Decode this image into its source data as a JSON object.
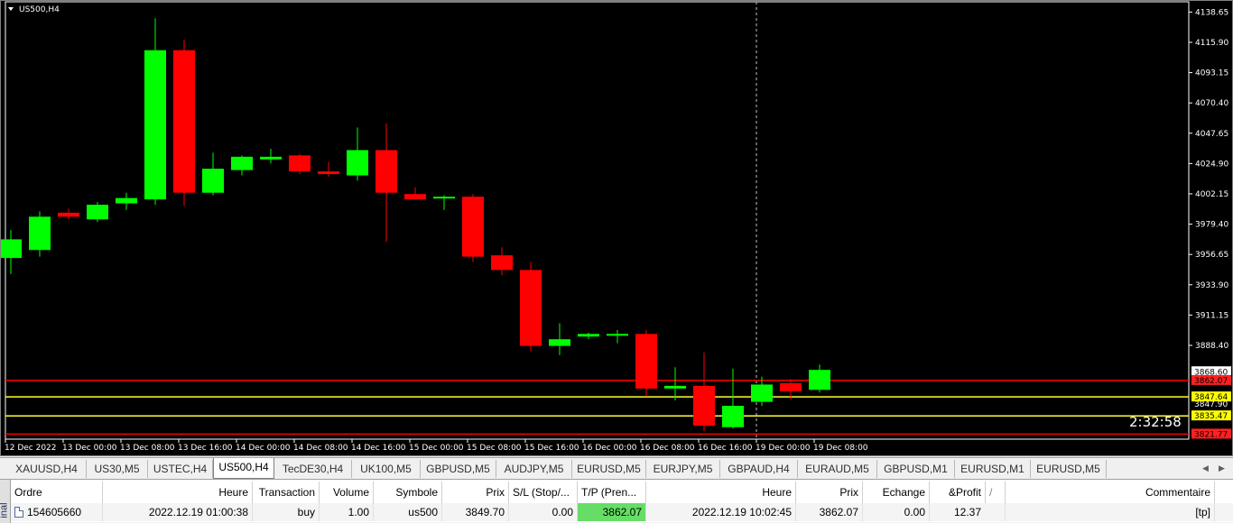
{
  "chart_title": "US500,H4",
  "chart_data": {
    "type": "candlestick",
    "symbol": "US500",
    "timeframe": "H4",
    "ylim": [
      3822,
      4150
    ],
    "y_ticks": [
      "4138.65",
      "4115.90",
      "4093.15",
      "4070.40",
      "4047.65",
      "4024.90",
      "4002.15",
      "3979.40",
      "3956.65",
      "3933.90",
      "3911.15",
      "3888.40"
    ],
    "y_ticks_values": [
      4138.65,
      4115.9,
      4093.15,
      4070.4,
      4047.65,
      4024.9,
      4002.15,
      3979.4,
      3956.65,
      3933.9,
      3911.15,
      3888.4
    ],
    "x_labels": [
      "12 Dec 2022",
      "13 Dec 00:00",
      "13 Dec 08:00",
      "13 Dec 16:00",
      "14 Dec 00:00",
      "14 Dec 08:00",
      "14 Dec 16:00",
      "15 Dec 00:00",
      "15 Dec 08:00",
      "15 Dec 16:00",
      "16 Dec 00:00",
      "16 Dec 08:00",
      "16 Dec 16:00",
      "19 Dec 00:00",
      "19 Dec 08:00"
    ],
    "candles": [
      {
        "o": 3954,
        "h": 3975,
        "l": 3942,
        "c": 3968
      },
      {
        "o": 3960,
        "h": 3989,
        "l": 3955,
        "c": 3985
      },
      {
        "o": 3988,
        "h": 3991,
        "l": 3983,
        "c": 3985
      },
      {
        "o": 3983,
        "h": 3996,
        "l": 3981,
        "c": 3994
      },
      {
        "o": 3995,
        "h": 4003,
        "l": 3990,
        "c": 3999
      },
      {
        "o": 3998,
        "h": 4134,
        "l": 3994,
        "c": 4110
      },
      {
        "o": 4110,
        "h": 4118,
        "l": 3993,
        "c": 4003
      },
      {
        "o": 4003,
        "h": 4033,
        "l": 4001,
        "c": 4021
      },
      {
        "o": 4020,
        "h": 4031,
        "l": 4016,
        "c": 4030
      },
      {
        "o": 4028,
        "h": 4036,
        "l": 4025,
        "c": 4030
      },
      {
        "o": 4031,
        "h": 4032,
        "l": 4017,
        "c": 4019
      },
      {
        "o": 4019,
        "h": 4026,
        "l": 4015,
        "c": 4017
      },
      {
        "o": 4016,
        "h": 4052,
        "l": 4012,
        "c": 4035
      },
      {
        "o": 4035,
        "h": 4055,
        "l": 3966,
        "c": 4003
      },
      {
        "o": 4002,
        "h": 4007,
        "l": 3998,
        "c": 3998
      },
      {
        "o": 3999,
        "h": 4001,
        "l": 3990,
        "c": 4000
      },
      {
        "o": 4000,
        "h": 4002,
        "l": 3951,
        "c": 3955
      },
      {
        "o": 3956,
        "h": 3962,
        "l": 3941,
        "c": 3945
      },
      {
        "o": 3945,
        "h": 3951,
        "l": 3884,
        "c": 3888
      },
      {
        "o": 3888,
        "h": 3905,
        "l": 3881,
        "c": 3893
      },
      {
        "o": 3895,
        "h": 3898,
        "l": 3893,
        "c": 3897
      },
      {
        "o": 3896,
        "h": 3900,
        "l": 3890,
        "c": 3897
      },
      {
        "o": 3897,
        "h": 3900,
        "l": 3850,
        "c": 3856
      },
      {
        "o": 3856,
        "h": 3872,
        "l": 3847,
        "c": 3858
      },
      {
        "o": 3858,
        "h": 3883,
        "l": 3824,
        "c": 3828
      },
      {
        "o": 3827,
        "h": 3871,
        "l": 3826,
        "c": 3843
      },
      {
        "o": 3846,
        "h": 3865,
        "l": 3843,
        "c": 3859
      },
      {
        "o": 3860,
        "h": 3863,
        "l": 3848,
        "c": 3854
      },
      {
        "o": 3855,
        "h": 3874,
        "l": 3853,
        "c": 3870
      }
    ],
    "levels": [
      {
        "value": 3862.07,
        "label": "3862.07",
        "color": "#ff2020",
        "line": "#ff0000"
      },
      {
        "value": 3849.7,
        "label": "3847.64",
        "color": "#ffff00",
        "line": "#ffff30"
      },
      {
        "value": 3835.47,
        "label": "3835.47",
        "color": "#ffff00",
        "line": "#ffff30"
      },
      {
        "value": 3821.77,
        "label": "3821.77",
        "color": "#ff2020",
        "line": "#ff0000"
      }
    ],
    "current_price_label": "3868.60",
    "hidden_label": "3847.90",
    "countdown": "2:32:58",
    "up_color": "#00ff00",
    "down_color": "#ff0000"
  },
  "tabs": [
    "XAUUSD,H4",
    "US30,M5",
    "USTEC,H4",
    "US500,H4",
    "TecDE30,H4",
    "UK100,M5",
    "GBPUSD,M5",
    "AUDJPY,M5",
    "EURUSD,M5",
    "EURJPY,M5",
    "GBPAUD,H4",
    "EURAUD,M5",
    "GBPUSD,M1",
    "EURUSD,M1",
    "EURUSD,M5"
  ],
  "active_tab": "US500,H4",
  "terminal": {
    "side_label": "inal",
    "headers": {
      "ordre": "Ordre",
      "heure": "Heure",
      "transaction": "Transaction",
      "volume": "Volume",
      "symbole": "Symbole",
      "prix": "Prix",
      "sl": "S/L (Stop/...",
      "tp": "T/P (Pren...",
      "heure2": "Heure",
      "prix2": "Prix",
      "echange": "Echange",
      "profit": "&Profit",
      "sort": "/",
      "commentaire": "Commentaire"
    },
    "row": {
      "ordre": "154605660",
      "heure": "2022.12.19 01:00:38",
      "transaction": "buy",
      "volume": "1.00",
      "symbole": "us500",
      "prix": "3849.70",
      "sl": "0.00",
      "tp": "3862.07",
      "heure2": "2022.12.19 10:02:45",
      "prix2": "3862.07",
      "echange": "0.00",
      "profit": "12.37",
      "commentaire": "[tp]"
    },
    "tp_highlight": "#66dd66"
  }
}
